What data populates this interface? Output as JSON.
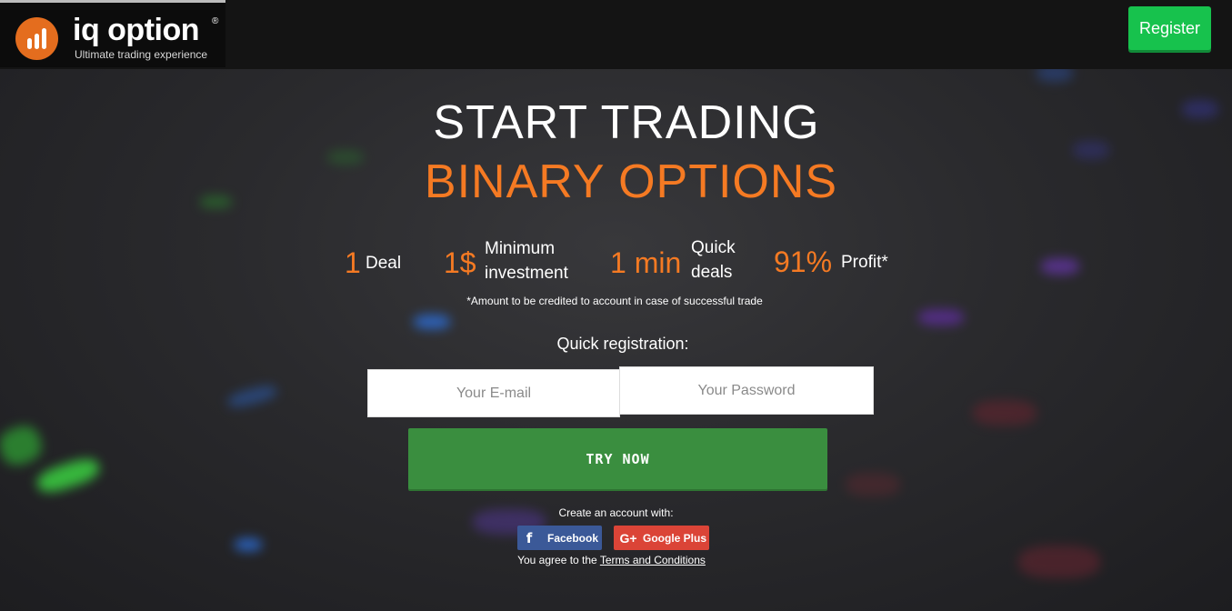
{
  "header": {
    "logo_text": "iq option",
    "logo_registered": "®",
    "tagline": "Ultimate trading experience",
    "register_label": "Register"
  },
  "hero": {
    "title_line1": "START TRADING",
    "title_line2": "BINARY OPTIONS"
  },
  "stats": [
    {
      "value": "1",
      "label_line1": "Deal",
      "label_line2": ""
    },
    {
      "value": "1$",
      "label_line1": "Minimum",
      "label_line2": "investment"
    },
    {
      "value": "1 min",
      "label_line1": "Quick",
      "label_line2": "deals"
    },
    {
      "value": "91%",
      "label_line1": "Profit*",
      "label_line2": ""
    }
  ],
  "footnote": "*Amount to be credited to account in case of successful trade",
  "form": {
    "title": "Quick registration:",
    "email_placeholder": "Your E-mail",
    "password_placeholder": "Your Password",
    "submit_label": "TRY NOW"
  },
  "social": {
    "create_label": "Create an account with:",
    "facebook_label": "Facebook",
    "google_label": "Google Plus",
    "agree_prefix": "You agree to the ",
    "terms_link": "Terms and Conditions"
  },
  "colors": {
    "accent_orange": "#f57a23",
    "register_green": "#17c24d",
    "try_green": "#3a8e3f",
    "facebook_blue": "#3b5998",
    "google_red": "#db4437"
  }
}
